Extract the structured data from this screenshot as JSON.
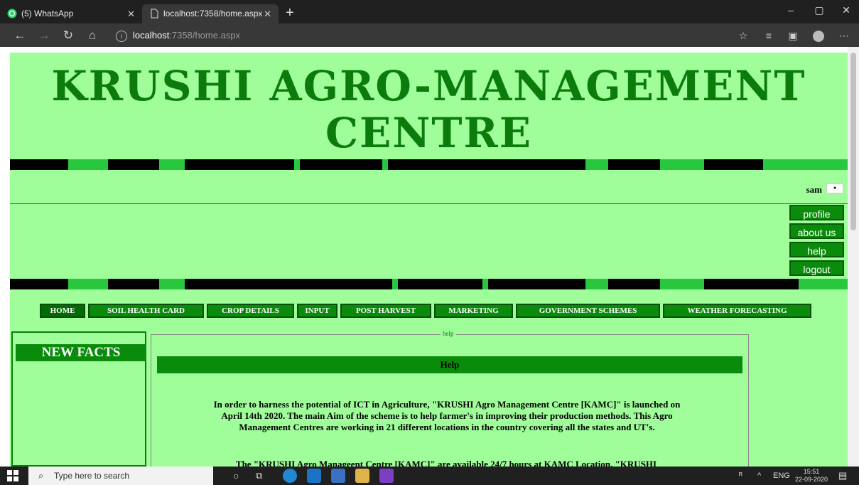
{
  "browser": {
    "tabs": [
      {
        "title": "(5) WhatsApp",
        "active": false
      },
      {
        "title": "localhost:7358/home.aspx",
        "active": true
      }
    ],
    "url_host": "localhost",
    "url_rest": ":7358/home.aspx",
    "window_controls": {
      "minimize": "–",
      "maximize": "▢",
      "close": "✕"
    }
  },
  "site": {
    "title": "KRUSHI AGRO-MANAGEMENT CENTRE",
    "username": "sam",
    "side_buttons": [
      "profile",
      "about us",
      "help",
      "logout"
    ],
    "menu": [
      "HOME",
      "SOIL HEALTH CARD",
      "CROP DETAILS",
      "INPUT",
      "POST HARVEST",
      "MARKETING",
      "GOVERNMENT SCHEMES",
      "WEATHER FORECASTING"
    ],
    "active_menu": "HOME",
    "left_panel_title": "NEW FACTS",
    "fieldset_legend": "help",
    "help_heading": "Help",
    "paragraph1": "In order to harness the potential of ICT in Agriculture, \"KRUSHI Agro Management Centre [KAMC]\" is launched on April 14th 2020. The main Aim of the scheme is to help farmer's in improving their production methods. This Agro Management Centres are working in 21 different locations in the country covering all the states and UT's.",
    "paragraph2": "The \"KRUSHI Agro Manageent Centre [KAMC]\" are available 24/7 hours at KAMC Location. \"KRUSHI",
    "colors": {
      "page_bg": "#9ffd9a",
      "button_green": "#0b8b0b",
      "title_green": "#0b7c0b",
      "accent_green": "#28c73d"
    }
  },
  "taskbar": {
    "search_placeholder": "Type here to search",
    "language": "ENG",
    "time": "15:51",
    "date": "22-09-2020"
  }
}
